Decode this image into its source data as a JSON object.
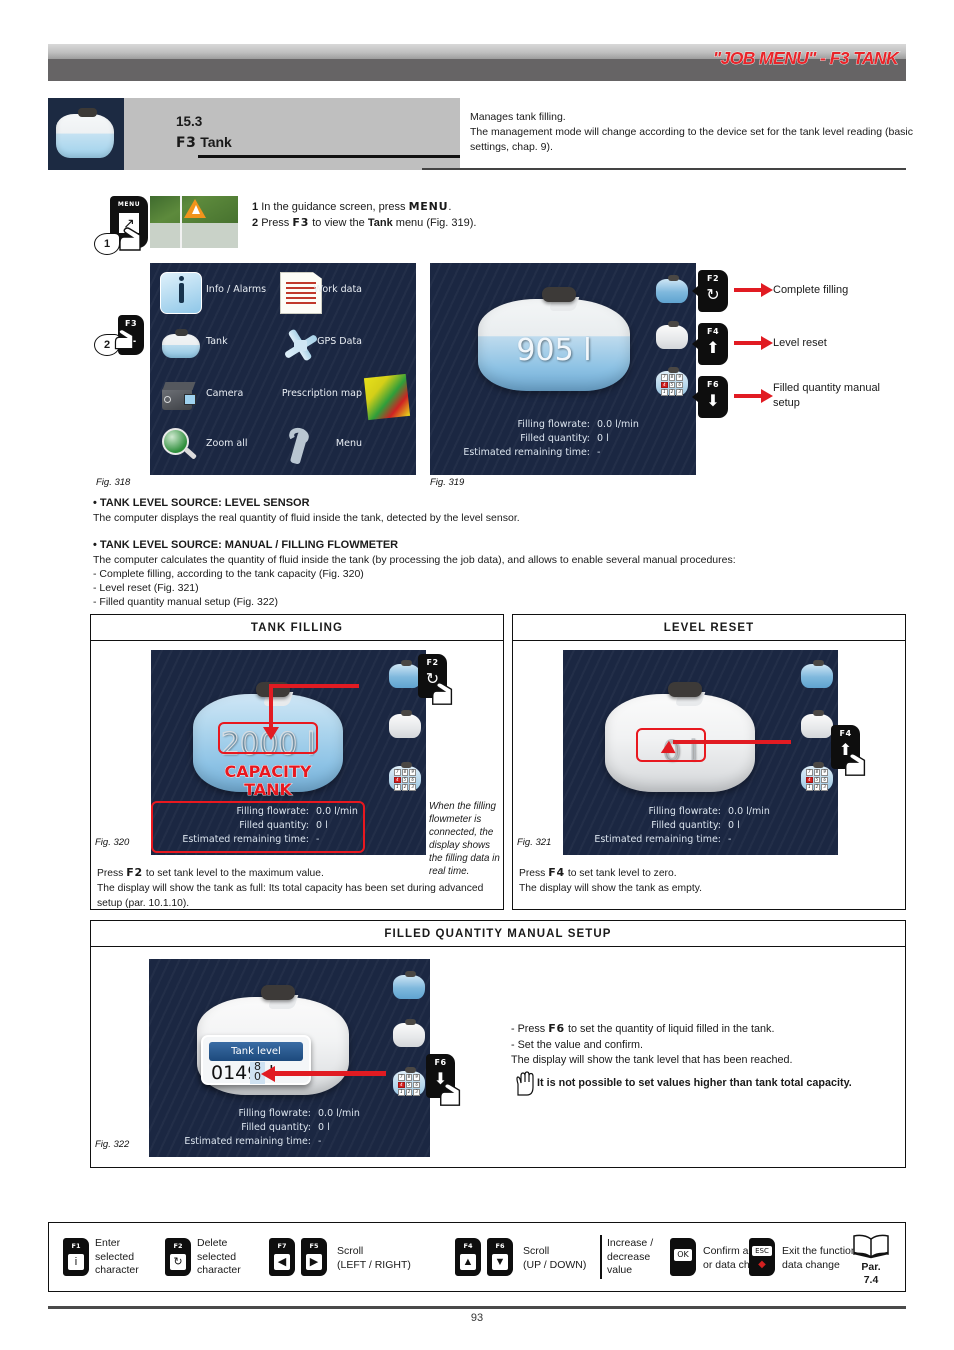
{
  "header": {
    "title": "\"JOB MENU\" - F3 TANK"
  },
  "section": {
    "number": "15.3",
    "key": "F3",
    "name": "Tank",
    "description": "Manages tank filling.\nThe management mode will change according to the device set for the tank level reading (basic settings, chap. 9)."
  },
  "steps": {
    "step1_num": "1",
    "step1_pre": "In the guidance screen, press ",
    "step1_key": "MENU",
    "step1_post": ".",
    "step2_num": "2",
    "step2_pre": "Press ",
    "step2_key": "F3",
    "step2_mid": " to view the ",
    "step2_bold": "Tank",
    "step2_post": " menu (Fig. 319).",
    "menu_key_label": "MENU",
    "callout_1": "1",
    "callout_2": "2",
    "f3_key_label": "F3"
  },
  "fig318": {
    "caption": "Fig. 318",
    "items": [
      {
        "label": "Info / Alarms",
        "icon": "info-icon"
      },
      {
        "label": "Work data",
        "icon": "document-icon"
      },
      {
        "label": "Tank",
        "icon": "tank-icon"
      },
      {
        "label": "GPS Data",
        "icon": "satellite-icon"
      },
      {
        "label": "Camera",
        "icon": "camera-icon"
      },
      {
        "label": "Prescription map",
        "icon": "map-icon"
      },
      {
        "label": "Zoom all",
        "icon": "magnifier-icon"
      },
      {
        "label": "Menu",
        "icon": "wrench-icon"
      }
    ]
  },
  "fig319": {
    "caption": "Fig. 319",
    "tank_value": "905 l",
    "data": [
      {
        "label": "Filling flowrate:",
        "value": "0.0 l/min"
      },
      {
        "label": "Filled quantity:",
        "value": "0 l"
      },
      {
        "label": "Estimated remaining time:",
        "value": "-"
      }
    ],
    "callouts": [
      {
        "key": "F2",
        "glyph": "complete-filling-icon",
        "text": "Complete filling"
      },
      {
        "key": "F4",
        "glyph": "up-arrow-icon",
        "text": "Level reset"
      },
      {
        "key": "F6",
        "glyph": "down-arrow-icon",
        "text": "Filled quantity manual\nsetup"
      }
    ]
  },
  "body": {
    "h1": "• TANK LEVEL SOURCE: LEVEL SENSOR",
    "p1": "The computer displays the real quantity of fluid inside the tank, detected by the level sensor.",
    "h2": "• TANK LEVEL SOURCE: MANUAL / FILLING FLOWMETER",
    "p2": "The computer calculates the quantity of fluid inside the tank (by processing the job data), and allows to enable several manual procedures:",
    "li1": "- Complete filling, according to the tank capacity (Fig. 320)",
    "li2": "- Level reset (Fig. 321)",
    "li3": "- Filled quantity manual setup (Fig. 322)"
  },
  "panel_tank_filling": {
    "title": "TANK FILLING",
    "caption": "Fig. 320",
    "tank_value": "2000 l",
    "capacity_line1": "CAPACITY",
    "capacity_line2": "TANK",
    "key": "F2",
    "data": [
      {
        "label": "Filling flowrate:",
        "value": "0.0 l/min"
      },
      {
        "label": "Filled quantity:",
        "value": "0 l"
      },
      {
        "label": "Estimated remaining time:",
        "value": "-"
      }
    ],
    "note": "When the filling flowmeter is connected, the display shows the filling data in real time.",
    "text_pre": "Press ",
    "text_key": "F2",
    "text_post": " to set tank level to the maximum value.",
    "text_line2": "The display will show the tank as full: Its total capacity has been set during advanced setup (par. 10.1.10)."
  },
  "panel_level_reset": {
    "title": "LEVEL RESET",
    "caption": "Fig. 321",
    "tank_value": "0 l",
    "key": "F4",
    "data": [
      {
        "label": "Filling flowrate:",
        "value": "0.0 l/min"
      },
      {
        "label": "Filled quantity:",
        "value": "0 l"
      },
      {
        "label": "Estimated remaining time:",
        "value": "-"
      }
    ],
    "text_pre": "Press ",
    "text_key": "F4",
    "text_post": "  to set tank level to zero.",
    "text_line2": "The display will show the tank as empty."
  },
  "panel_manual_setup": {
    "title": "FILLED QUANTITY MANUAL SETUP",
    "caption": "Fig. 322",
    "popup_title": "Tank level",
    "popup_value": "0149",
    "popup_spin_top": "8",
    "popup_spin_bottom": "0",
    "popup_unit": "l",
    "key": "F6",
    "data": [
      {
        "label": "Filling flowrate:",
        "value": "0.0 l/min"
      },
      {
        "label": "Filled quantity:",
        "value": "0 l"
      },
      {
        "label": "Estimated remaining time:",
        "value": "-"
      }
    ],
    "line1_pre": "- Press ",
    "line1_key": "F6",
    "line1_post": " to set the quantity of liquid filled in the tank.",
    "line2": "- Set the value and confirm.",
    "line3": "The display will show the tank level that has been reached.",
    "warning": "It is not possible to set values higher than tank total capacity."
  },
  "legend": {
    "items": [
      {
        "key": "F1",
        "glyph": "enter-icon",
        "text": "Enter\nselected\ncharacter"
      },
      {
        "key": "F2",
        "glyph": "delete-icon",
        "text": "Delete\nselected\ncharacter"
      },
      {
        "key": "F7",
        "glyph": "left-arrow-icon",
        "key2": "F5",
        "glyph2": "right-arrow-icon",
        "text": "Scroll\n(LEFT / RIGHT)"
      },
      {
        "key": "F4",
        "glyph": "up-arrow-icon",
        "key2": "F6",
        "glyph2": "down-arrow-icon",
        "text": "Scroll\n(UP / DOWN)"
      }
    ],
    "increase_decrease": "Increase /\ndecrease\nvalue",
    "ok_key": "OK",
    "ok_text": "Confirm access\nor data change",
    "esc_key": "ESC",
    "esc_text": "Exit the function or\ndata change",
    "par_label": "Par.",
    "par_value": "7.4"
  },
  "footer": {
    "page": "93"
  },
  "colors": {
    "accent_red": "#e8181f",
    "header_dark": "#666465",
    "screen_bg": "#1b2742",
    "section_gray": "#bfbfbf"
  }
}
